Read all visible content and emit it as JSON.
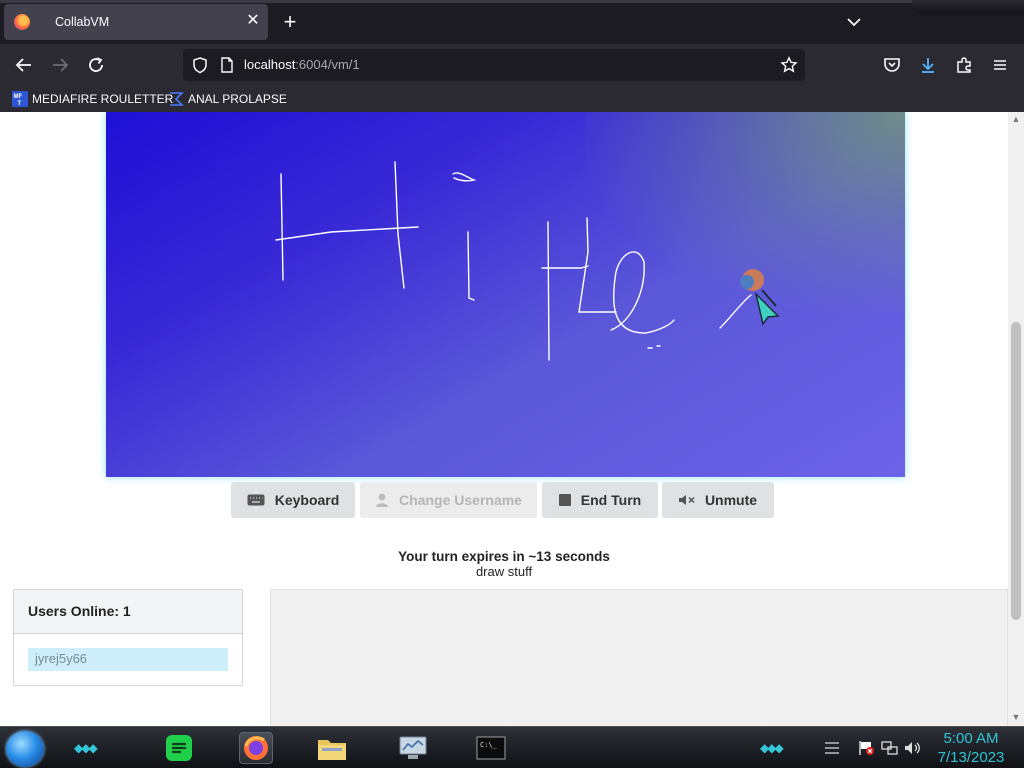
{
  "browser": {
    "tab_title": "CollabVM",
    "url_host": "localhost",
    "url_rest": ":6004/vm/1",
    "bookmarks": [
      {
        "label": "MEDIAFIRE ROULETTER",
        "icon": "mediafire-icon"
      },
      {
        "label": "ANAL PROLAPSE",
        "icon": "sigma-icon"
      }
    ]
  },
  "vm": {
    "buttons": {
      "keyboard": "Keyboard",
      "change_username": "Change Username",
      "end_turn": "End Turn",
      "unmute": "Unmute"
    },
    "turn_status": "Your turn expires in ~13 seconds",
    "motd": "draw stuff"
  },
  "users": {
    "header": "Users Online: 1",
    "list": [
      "jyrej5y66"
    ]
  },
  "taskbar": {
    "time": "5:00 AM",
    "date": "7/13/2023"
  },
  "colors": {
    "accent_cyan": "#2ec4d6",
    "button_bg": "#e0e1e2",
    "user_highlight": "#cdeefa"
  }
}
